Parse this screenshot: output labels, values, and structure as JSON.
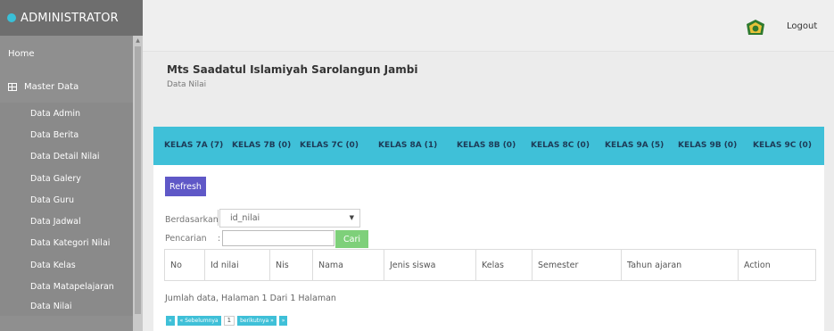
{
  "sidebar": {
    "brand": "ADMINISTRATOR",
    "home": "Home",
    "master": "Master Data",
    "items": [
      "Data Admin",
      "Data Berita",
      "Data Detail Nilai",
      "Data Galery",
      "Data Guru",
      "Data Jadwal",
      "Data Kategori Nilai",
      "Data Kelas",
      "Data Matapelajaran",
      "Data Nilai"
    ]
  },
  "header": {
    "logout": "Logout"
  },
  "page": {
    "title": "Mts Saadatul Islamiyah Sarolangun Jambi",
    "subtitle": "Data Nilai"
  },
  "tabs": [
    "KELAS 7A (7)",
    "KELAS 7B (0)",
    "KELAS 7C (0)",
    "KELAS 8A (1)",
    "KELAS 8B (0)",
    "KELAS 8C (0)",
    "KELAS 9A (5)",
    "KELAS 9B (0)",
    "KELAS 9C (0)"
  ],
  "toolbar": {
    "refresh": "Refresh",
    "filter_label": "Berdasarkan",
    "filter_value": "id_nilai",
    "search_label": "Pencarian",
    "search_colon": ":",
    "search_button": "Cari"
  },
  "table": {
    "headers": [
      "No",
      "Id nilai",
      "Nis",
      "Nama",
      "Jenis siswa",
      "Kelas",
      "Semester",
      "Tahun ajaran",
      "Action"
    ]
  },
  "summary": "Jumlah data, Halaman 1 Dari 1 Halaman",
  "pagination": {
    "first": "«",
    "prev": "« Sebelumnya",
    "page": "1",
    "next": "berikutnya »",
    "last": "»"
  },
  "colors": {
    "accent": "#3fc0d8",
    "refresh": "#5f58c7",
    "cari": "#7ed07a",
    "sidebar": "#8f8f8f"
  }
}
